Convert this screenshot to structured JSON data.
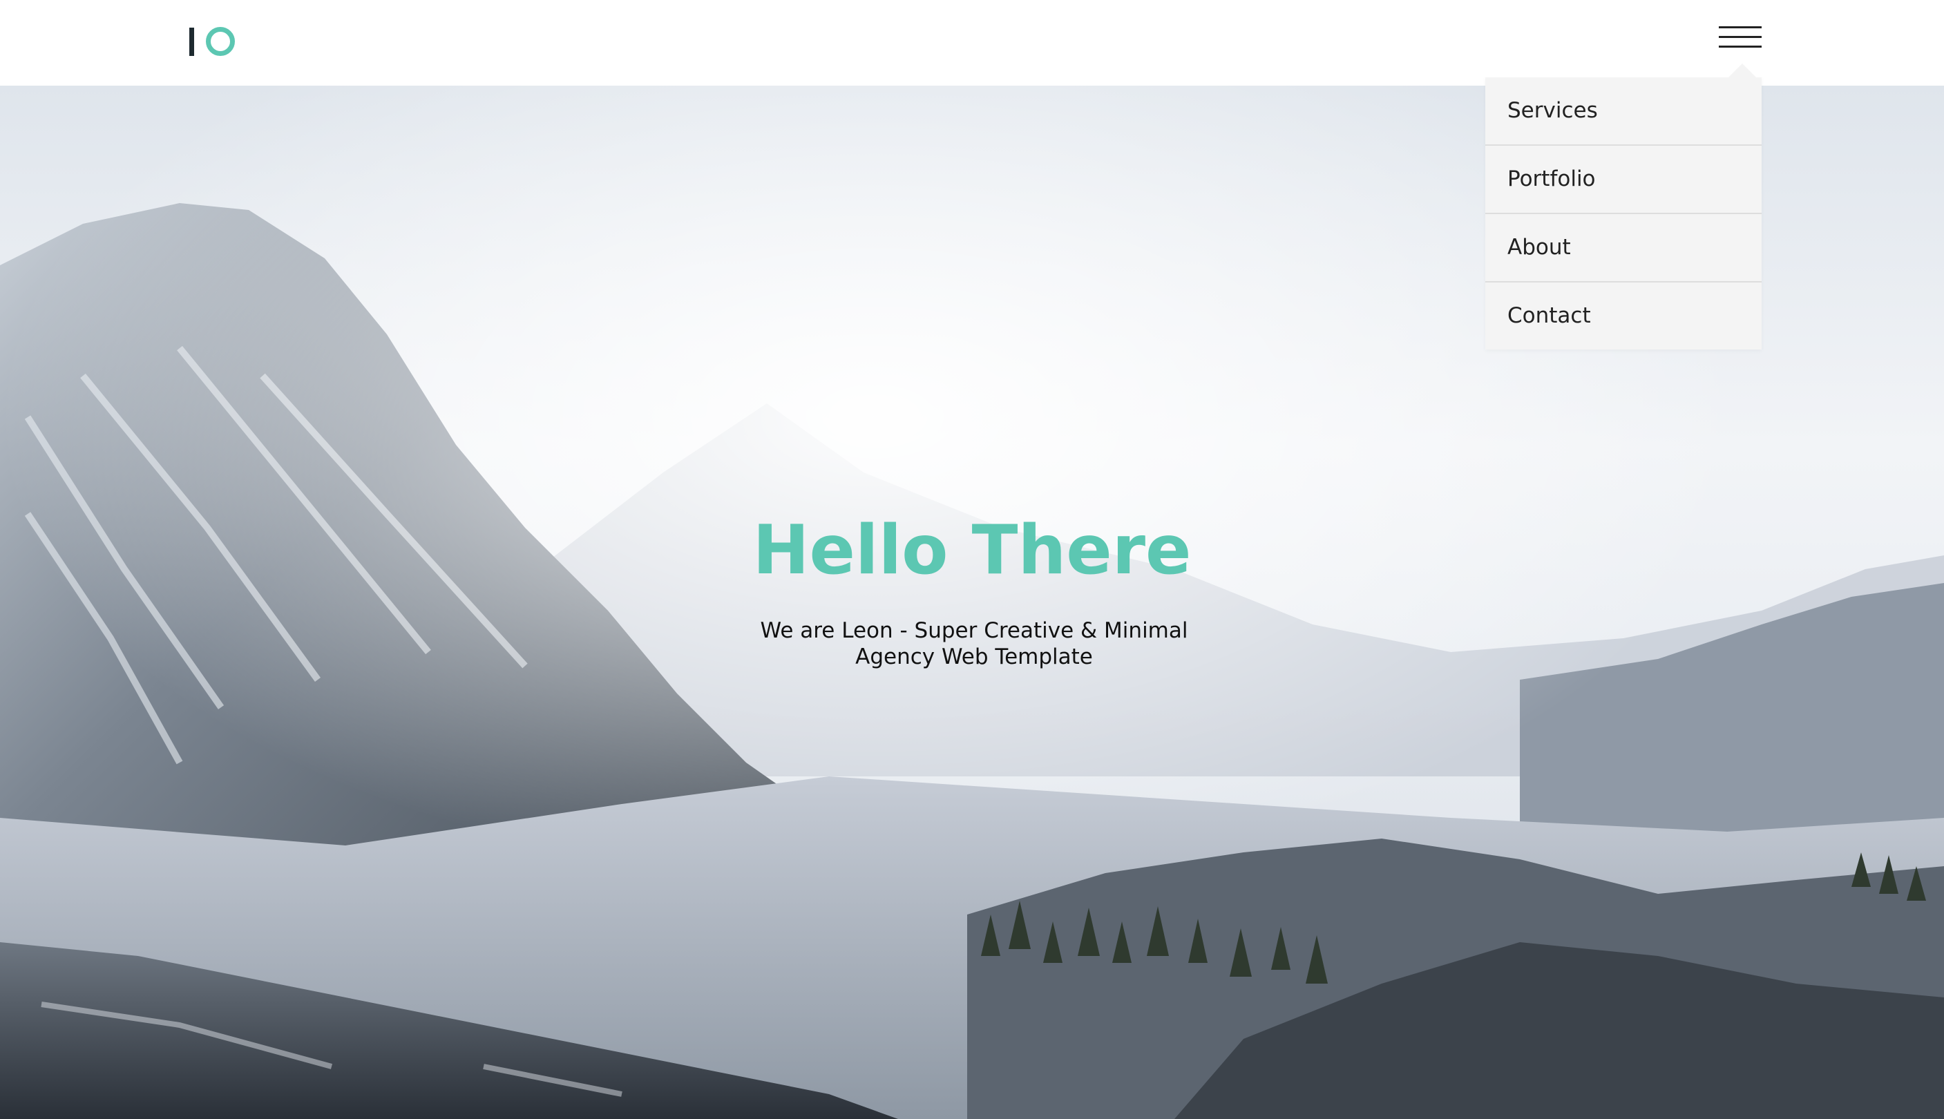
{
  "header": {
    "logo_icon": "logo-mark",
    "menu_icon": "hamburger-menu-icon"
  },
  "menu": {
    "items": [
      {
        "label": "Services"
      },
      {
        "label": "Portfolio"
      },
      {
        "label": "About"
      },
      {
        "label": "Contact"
      }
    ]
  },
  "hero": {
    "title": "Hello There",
    "subtitle": "We are Leon - Super Creative & Minimal Agency Web Template",
    "background": "snowy-mountain-landscape"
  },
  "colors": {
    "accent": "#5cc7b2",
    "logo_dark": "#1e2a30",
    "menu_bg": "#f4f4f4"
  }
}
